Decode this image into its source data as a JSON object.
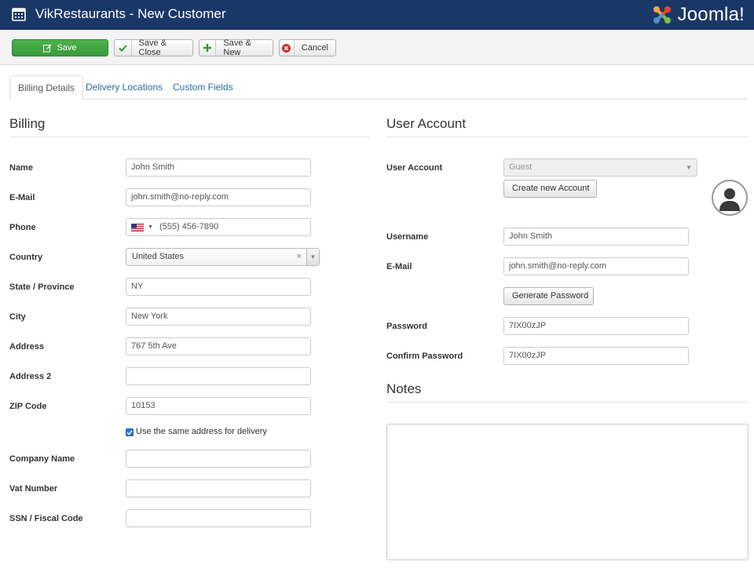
{
  "header": {
    "title": "VikRestaurants - New Customer",
    "brand": "Joomla!",
    "app_icon": "calendar-icon",
    "bg_color": "#1a3867"
  },
  "toolbar": {
    "save_label": "Save",
    "save_close_label": "Save & Close",
    "save_new_label": "Save & New",
    "cancel_label": "Cancel",
    "save_color": "#3fa33f"
  },
  "tabs": [
    {
      "label": "Billing Details",
      "active": true
    },
    {
      "label": "Delivery Locations",
      "active": false
    },
    {
      "label": "Custom Fields",
      "active": false
    }
  ],
  "billing": {
    "title": "Billing",
    "fields": {
      "name": {
        "label": "Name",
        "value": "John Smith"
      },
      "email": {
        "label": "E-Mail",
        "value": "john.smith@no-reply.com"
      },
      "phone": {
        "label": "Phone",
        "value": "(555) 456-7890"
      },
      "country": {
        "label": "Country",
        "value": "United States"
      },
      "state": {
        "label": "State / Province",
        "value": "NY"
      },
      "city": {
        "label": "City",
        "value": "New York"
      },
      "address": {
        "label": "Address",
        "value": "767 5th Ave"
      },
      "address2": {
        "label": "Address 2",
        "value": ""
      },
      "zip": {
        "label": "ZIP Code",
        "value": "10153"
      },
      "same_delivery": {
        "label": "Use the same address for delivery",
        "checked": true
      },
      "company": {
        "label": "Company Name",
        "value": ""
      },
      "vat": {
        "label": "Vat Number",
        "value": ""
      },
      "ssn": {
        "label": "SSN / Fiscal Code",
        "value": ""
      }
    }
  },
  "account": {
    "title": "User Account",
    "user_account": {
      "label": "User Account",
      "value": "Guest"
    },
    "create_button": "Create new Account",
    "username": {
      "label": "Username",
      "value": "John Smith"
    },
    "email": {
      "label": "E-Mail",
      "value": "john.smith@no-reply.com"
    },
    "generate_button": "Generate Password",
    "password": {
      "label": "Password",
      "value": "7IX00zJP"
    },
    "confirm_password": {
      "label": "Confirm Password",
      "value": "7IX00zJP"
    }
  },
  "notes": {
    "title": "Notes",
    "value": ""
  }
}
